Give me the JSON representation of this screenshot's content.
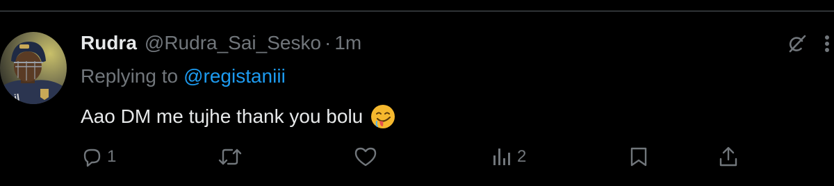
{
  "tweet": {
    "author_name": "Rudra",
    "author_handle": "@Rudra_Sai_Sesko",
    "separator": "·",
    "timestamp": "1m",
    "reply_prefix": "Replying to",
    "reply_mention": "@registaniii",
    "text": "Aao DM me tujhe thank you bolu",
    "emoji": "drooling-face",
    "avatar_jersey_text": "mil"
  },
  "actions": {
    "reply_count": "1",
    "retweet_count": "",
    "like_count": "",
    "views_count": "2"
  },
  "colors": {
    "background": "#000000",
    "primary_text": "#e7e9ea",
    "secondary_text": "#71767b",
    "accent": "#1d9bf0",
    "divider": "#2f3336"
  },
  "icons": {
    "grok": "grok-icon",
    "more": "more-icon",
    "reply": "reply-icon",
    "retweet": "retweet-icon",
    "like": "heart-icon",
    "views": "views-icon",
    "bookmark": "bookmark-icon",
    "share": "share-icon"
  }
}
